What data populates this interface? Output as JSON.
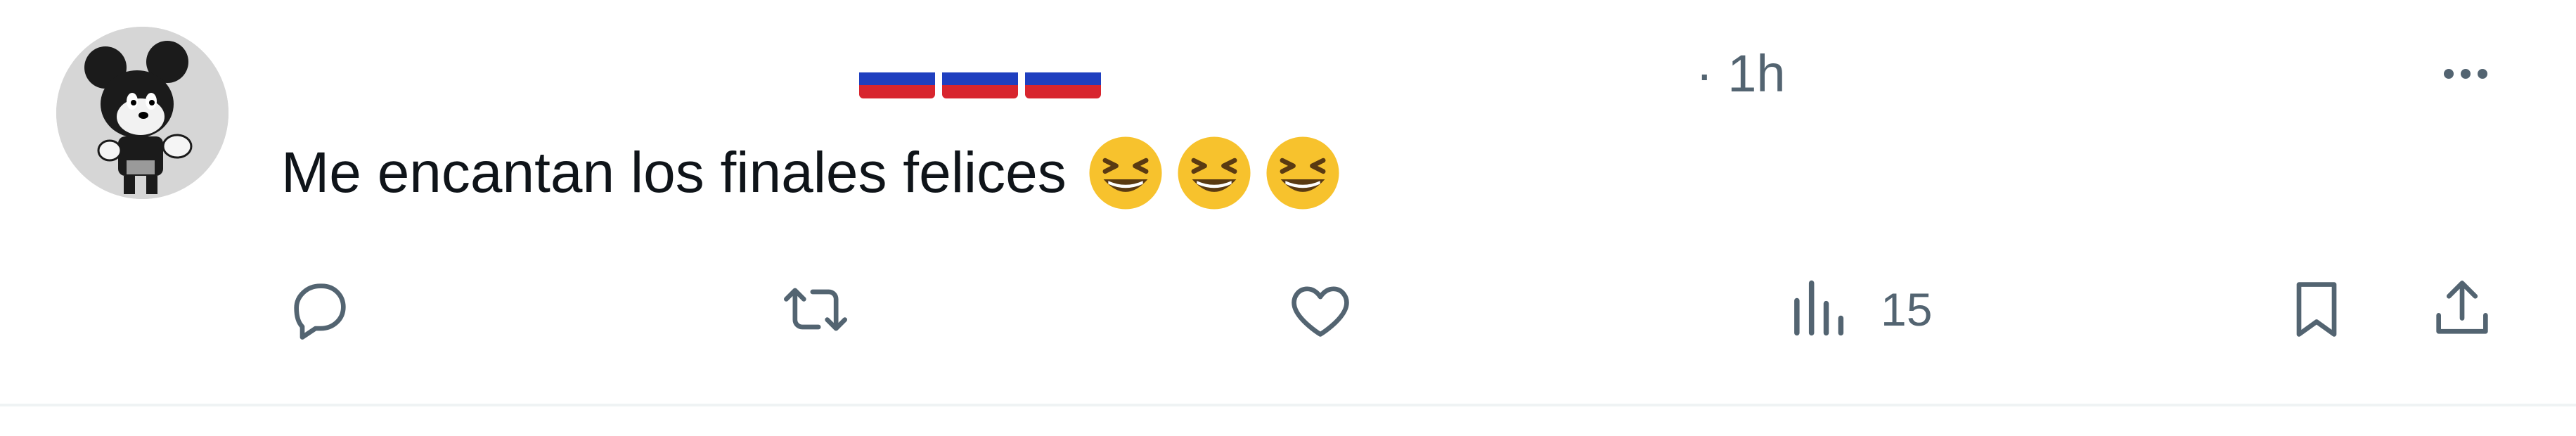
{
  "post": {
    "display_name": "🇷🇺🇷🇺🇷🇺",
    "timestamp": "· 1h",
    "text": "Me encantan los finales felices",
    "emojis": [
      "grinning-squinting-face",
      "grinning-squinting-face",
      "grinning-squinting-face"
    ],
    "more_icon": "more-horizontal-icon"
  },
  "actions": {
    "reply": {
      "icon": "reply-icon"
    },
    "repost": {
      "icon": "repost-icon"
    },
    "like": {
      "icon": "heart-icon"
    },
    "views": {
      "icon": "analytics-icon",
      "count": "15"
    },
    "bookmark": {
      "icon": "bookmark-icon"
    },
    "share": {
      "icon": "share-icon"
    }
  },
  "colors": {
    "text": "#0f1419",
    "secondary": "#536471",
    "divider": "#eff3f4",
    "emoji_yellow": "#f7c22d",
    "flag_white": "#ffffff",
    "flag_blue": "#1f3fbf",
    "flag_red": "#d8252e"
  }
}
